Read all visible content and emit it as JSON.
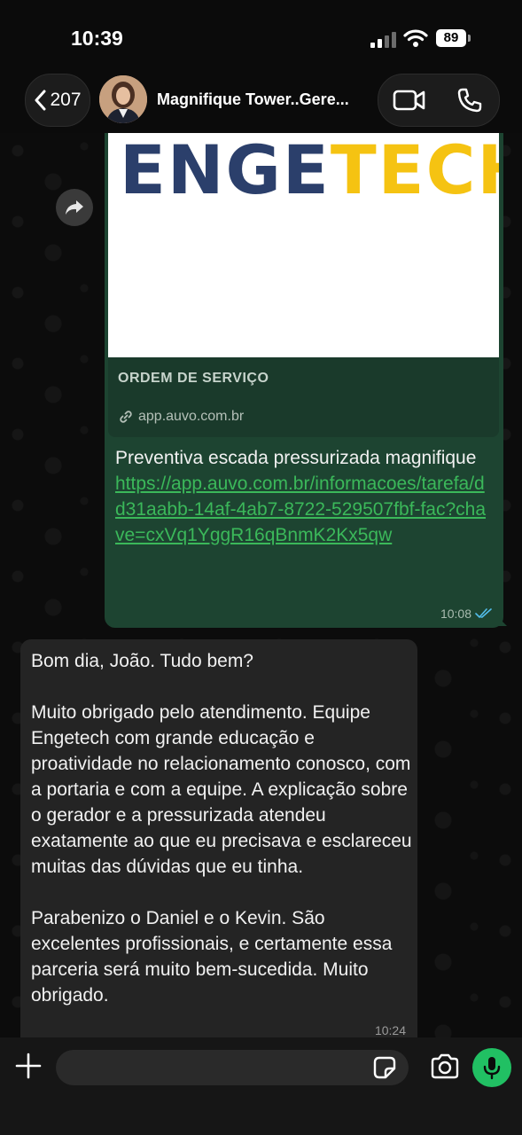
{
  "status_bar": {
    "time": "10:39",
    "battery": "89"
  },
  "header": {
    "back_count": "207",
    "title": "Magnifique Tower..Gere..."
  },
  "outgoing": {
    "link_preview": {
      "logo_part1": "ENGE",
      "logo_part2": "TECH",
      "title": "ORDEM DE SERVIÇO",
      "domain": "app.auvo.com.br"
    },
    "text": "Preventiva escada pressurizada magnifique",
    "link": "https://app.auvo.com.br/informacoes/tarefa/dd31aabb-14af-4ab7-8722-529507fbf-fac?chave=cxVq1YggR16qBnmK2Kx5qw",
    "time": "10:08",
    "status": "read"
  },
  "incoming": {
    "paragraphs": [
      "Bom dia, João. Tudo bem?",
      "Muito obrigado pelo atendimento. Equipe Engetech com grande educação e proatividade no relacionamento conosco, com a portaria e com a equipe. A explicação sobre o gerador e a pressurizada atendeu exatamente ao que eu precisava e esclareceu muitas das dúvidas que eu tinha.",
      "Parabenizo o Daniel e o Kevin. São excelentes profissionais, e certamente essa parceria será muito bem-sucedida. Muito obrigado."
    ],
    "time": "10:24"
  },
  "composer": {
    "placeholder": ""
  },
  "colors": {
    "outgoing_bubble": "#1d4431",
    "incoming_bubble": "#242424",
    "link": "#3bb85a",
    "mic_button": "#21c063",
    "logo_blue": "#2b3f6b",
    "logo_yellow": "#f5c312"
  }
}
